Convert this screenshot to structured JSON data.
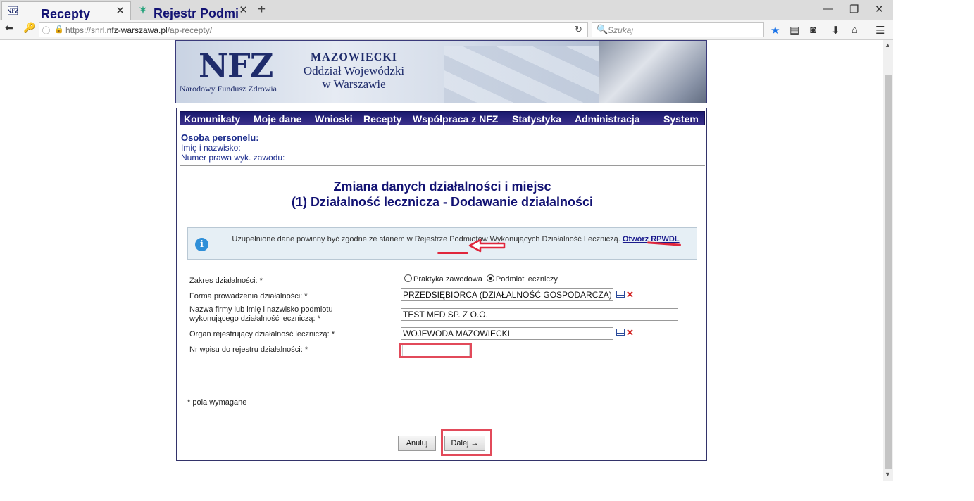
{
  "browser": {
    "tabs": [
      {
        "title": "Recepty",
        "favicon": "nfz-favicon"
      },
      {
        "title": "Rejestr Podmiotów Wyko...",
        "favicon": "rpwdl-favicon"
      }
    ],
    "new_tab": "+",
    "url_prefix": "https://snrl.",
    "url_domain": "nfz-warszawa.pl",
    "url_suffix": "/ap-recepty/",
    "search_placeholder": "Szukaj",
    "window_controls": {
      "minimize": "—",
      "restore": "❐",
      "close": "✕"
    }
  },
  "banner": {
    "logo": "NFZ",
    "logo_sub": "Narodowy Fundusz Zdrowia",
    "org_line1": "MAZOWIECKI",
    "org_line2": "Oddział Wojewódzki",
    "org_line3": "w Warszawie"
  },
  "menu": [
    "Komunikaty",
    "Moje dane",
    "Wnioski",
    "Recepty",
    "Współpraca z NFZ",
    "Statystyka",
    "Administracja",
    "System"
  ],
  "person": {
    "heading": "Osoba personelu:",
    "name_label": "Imię i nazwisko:",
    "license_label": "Numer prawa wyk. zawodu:"
  },
  "page": {
    "title_line1": "Zmiana danych działalności i miejsc",
    "title_line2": "(1) Działalność lecznicza - Dodawanie działalności"
  },
  "info": {
    "text": "Uzupełnione dane powinny być zgodne ze stanem w Rejestrze Podmiotów Wykonujących Działalność Leczniczą.",
    "link": "Otwórz RPWDL"
  },
  "form": {
    "scope_label": "Zakres działalności: *",
    "scope_options": [
      "Praktyka zawodowa",
      "Podmiot leczniczy"
    ],
    "scope_selected": "Podmiot leczniczy",
    "form_label": "Forma prowadzenia działalności: *",
    "form_value": "PRZEDSIĘBIORCA (DZIAŁALNOŚĆ GOSPODARCZA)",
    "company_label_line1": "Nazwa firmy lub imię i nazwisko podmiotu",
    "company_label_line2": "wykonującego działalność leczniczą: *",
    "company_value": "TEST MED SP. Z O.O.",
    "organ_label": "Organ rejestrujący działalność leczniczą: *",
    "organ_value": "WOJEWODA MAZOWIECKI",
    "registry_label": "Nr wpisu do rejestru działalności: *",
    "registry_value": ""
  },
  "required_note": "* pola wymagane",
  "buttons": {
    "cancel": "Anuluj",
    "next": "Dalej →"
  },
  "colors": {
    "menu_bg": "#1a1a6e",
    "title": "#121273",
    "highlight": "#e24a5a",
    "info_bg": "#e6eff5"
  }
}
